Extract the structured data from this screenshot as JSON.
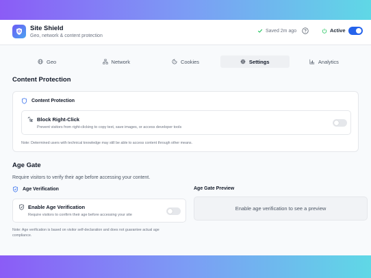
{
  "header": {
    "app_name": "Site Shield",
    "app_subtitle": "Geo, network & content protection",
    "saved_status": "Saved 2m ago",
    "status_label": "Active",
    "active_toggle": true
  },
  "tabs": [
    {
      "label": "Geo",
      "icon": "globe-icon",
      "active": false
    },
    {
      "label": "Network",
      "icon": "network-icon",
      "active": false
    },
    {
      "label": "Cookies",
      "icon": "cookie-icon",
      "active": false
    },
    {
      "label": "Settings",
      "icon": "gear-icon",
      "active": true
    },
    {
      "label": "Analytics",
      "icon": "chart-icon",
      "active": false
    }
  ],
  "content_protection": {
    "section_title": "Content Protection",
    "card_title": "Content Protection",
    "block_right_click": {
      "title": "Block Right-Click",
      "description": "Prevent visitors from right-clicking to copy text, save images, or access developer tools",
      "enabled": false
    },
    "note": "Note: Determined users with technical knowledge may still be able to access content through other means."
  },
  "age_gate": {
    "section_title": "Age Gate",
    "description": "Require visitors to verify their age before accessing your content.",
    "verification_title": "Age Verification",
    "enable": {
      "title": "Enable Age Verification",
      "description": "Require visitors to confirm their age before accessing your site",
      "enabled": false
    },
    "note_line1": "Note: Age verification is based on visitor self-declaration and does not guarantee actual age",
    "note_line2": "compliance.",
    "preview_title": "Age Gate Preview",
    "preview_placeholder": "Enable age verification to see a preview"
  },
  "colors": {
    "accent": "#2563eb",
    "gradient_start": "#8b5cf6",
    "gradient_end": "#5fd8e6",
    "success": "#22c55e"
  }
}
